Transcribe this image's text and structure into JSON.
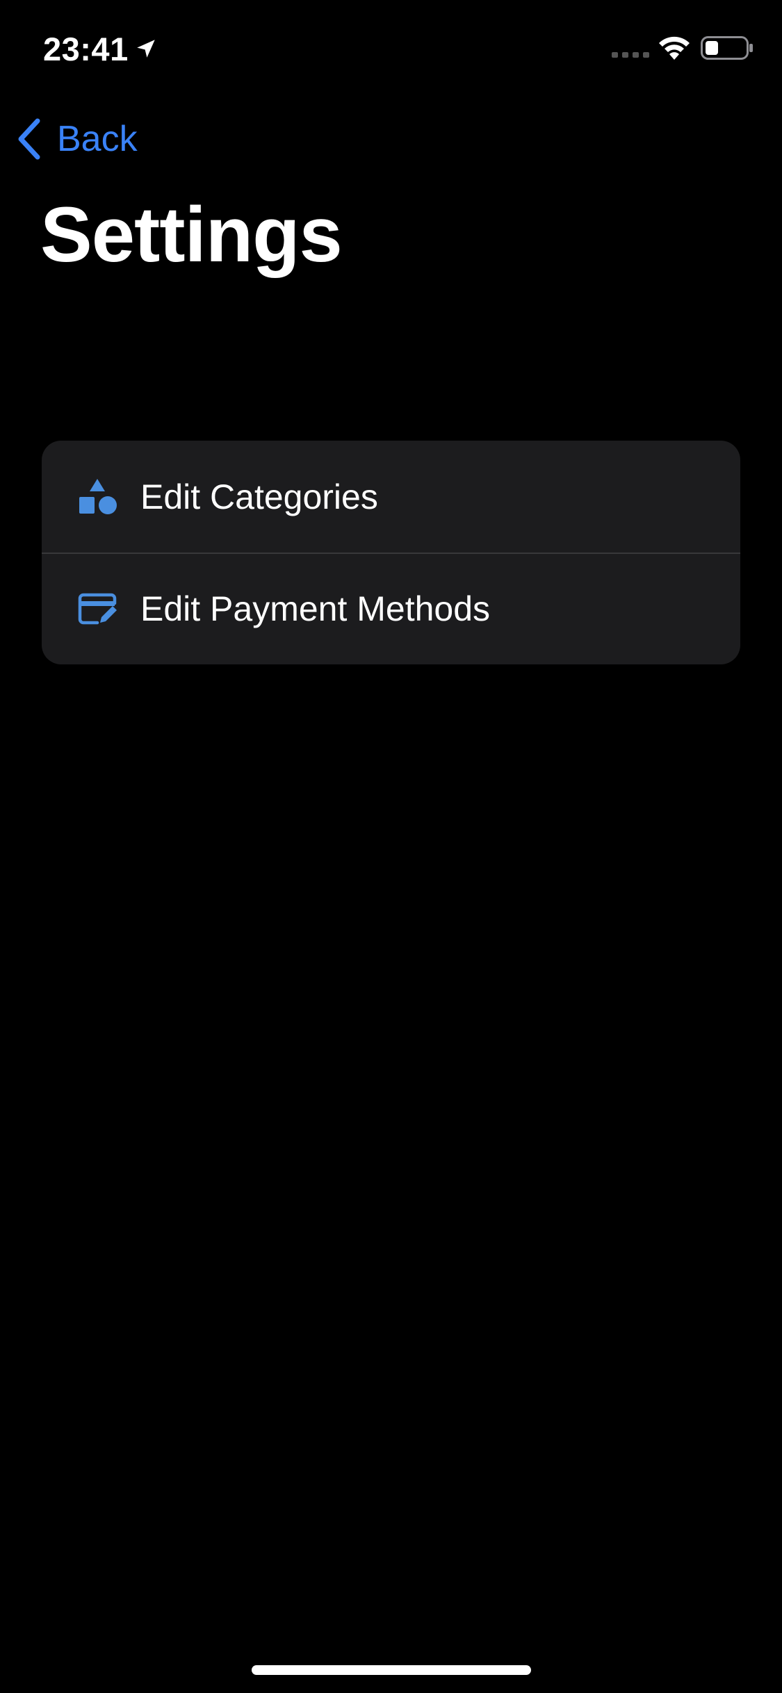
{
  "status_bar": {
    "time": "23:41",
    "icons": [
      "location-arrow-icon",
      "cellular-signal-icon",
      "wifi-icon",
      "battery-icon"
    ]
  },
  "nav": {
    "back_label": "Back"
  },
  "page": {
    "title": "Settings"
  },
  "settings": {
    "items": [
      {
        "label": "Edit Categories",
        "icon": "shapes-icon"
      },
      {
        "label": "Edit Payment Methods",
        "icon": "credit-card-edit-icon"
      }
    ]
  },
  "colors": {
    "background": "#000000",
    "accent": "#3a82f7",
    "icon_blue": "#4a8fe0",
    "card_background": "#1c1c1e",
    "separator": "#38383a",
    "text_primary": "#ffffff"
  }
}
